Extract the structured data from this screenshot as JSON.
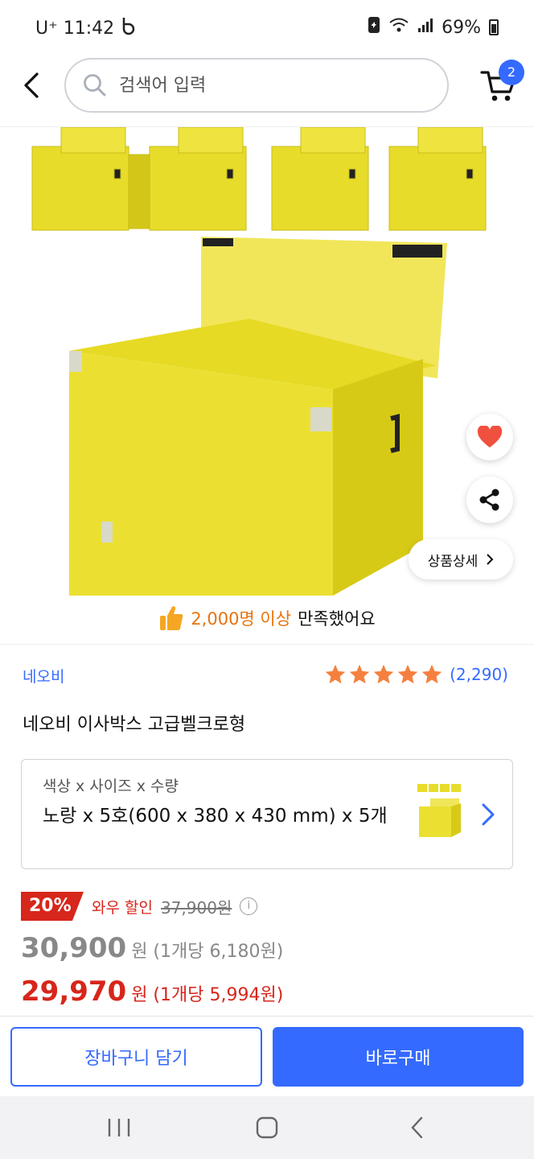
{
  "status_bar": {
    "carrier": "U⁺ 11:42",
    "battery": "69%"
  },
  "header": {
    "search_placeholder": "검색어 입력",
    "cart_count": "2"
  },
  "product": {
    "detail_button": "상품상세",
    "satisfaction": {
      "count": "2,000명 이상",
      "suffix": "만족했어요"
    },
    "brand": "네오비",
    "rating_count": "(2,290)",
    "title": "네오비 이사박스 고급벨크로형"
  },
  "option": {
    "label": "색상 x 사이즈 x 수량",
    "value": "노랑 x 5호(600 x 380 x 430 mm) x 5개"
  },
  "pricing": {
    "discount": "20%",
    "wow_label": "와우 할인",
    "original_price": "37,900원",
    "sale_price": "30,900",
    "sale_unit": "원 (1개당 6,180원)",
    "wow_price": "29,970",
    "wow_unit": "원 (1개당 5,994원)"
  },
  "actions": {
    "add_to_cart": "장바구니 담기",
    "buy_now": "바로구매"
  },
  "colors": {
    "accent": "#346aff",
    "sale_red": "#d7261b",
    "box_yellow": "#e8dc2a"
  }
}
